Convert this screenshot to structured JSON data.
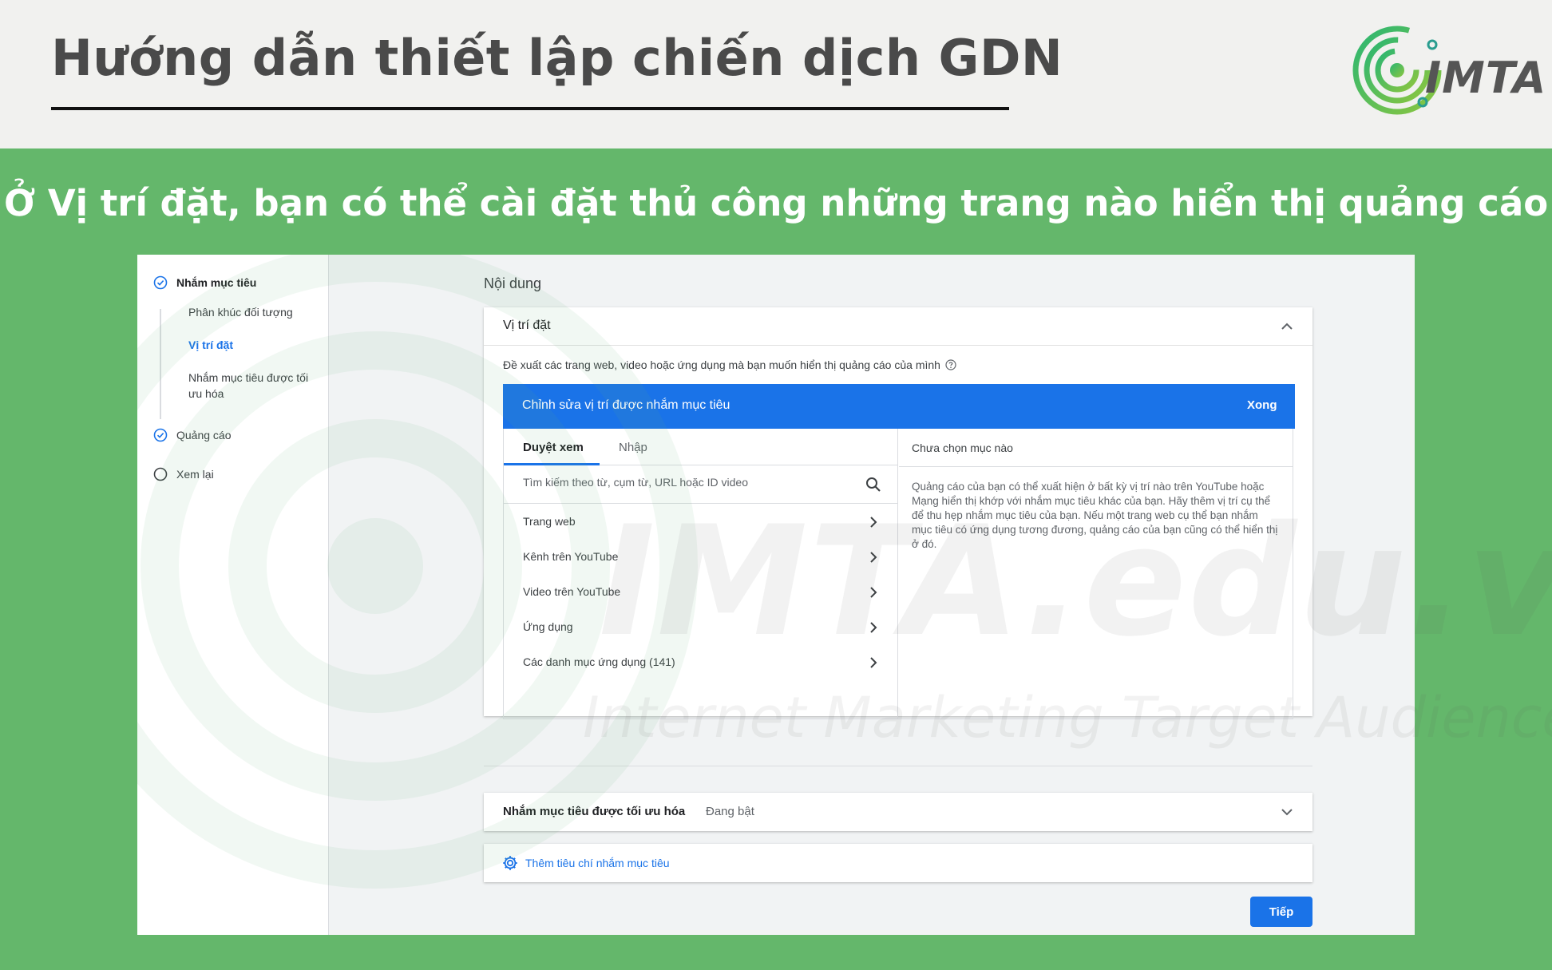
{
  "header": {
    "title": "Hướng dẫn thiết lập chiến dịch GDN",
    "logo_text": "IMTA"
  },
  "subtitle": "Ở Vị trí đặt, bạn có thể cài đặt thủ công những trang nào hiển thị quảng cáo",
  "watermark": {
    "main": "IMTA.edu.vn",
    "sub": "Internet Marketing Target Audience"
  },
  "sidebar": {
    "steps": [
      {
        "label": "Nhắm mục tiêu",
        "icon": "check-circle-icon"
      },
      {
        "label": "Quảng cáo",
        "icon": "check-circle-icon"
      },
      {
        "label": "Xem lại",
        "icon": "empty-circle-icon"
      }
    ],
    "sub_items": [
      {
        "label": "Phân khúc đối tượng"
      },
      {
        "label": "Vị trí đặt"
      },
      {
        "label": "Nhắm mục tiêu được tối ưu hóa"
      }
    ]
  },
  "content": {
    "section_label": "Nội dung",
    "placement_card": {
      "title": "Vị trí đặt",
      "description": "Đề xuất các trang web, video hoặc ứng dụng mà bạn muốn hiển thị quảng cáo của mình",
      "edit_bar_title": "Chỉnh sửa vị trí được nhắm mục tiêu",
      "done_label": "Xong",
      "tabs": [
        {
          "label": "Duyệt xem"
        },
        {
          "label": "Nhập"
        }
      ],
      "search_placeholder": "Tìm kiếm theo từ, cụm từ, URL hoặc ID video",
      "list": [
        {
          "label": "Trang web"
        },
        {
          "label": "Kênh trên YouTube"
        },
        {
          "label": "Video trên YouTube"
        },
        {
          "label": "Ứng dụng"
        },
        {
          "label": "Các danh mục ứng dụng (141)"
        }
      ],
      "right_header": "Chưa chọn mục nào",
      "right_text": "Quảng cáo của bạn có thể xuất hiện ở bất kỳ vị trí nào trên YouTube hoặc Mạng hiển thị khớp với nhắm mục tiêu khác của bạn. Hãy thêm vị trí cụ thể để thu hẹp nhắm mục tiêu của bạn. Nếu một trang web cụ thể bạn nhắm mục tiêu có ứng dụng tương đương, quảng cáo của bạn cũng có thể hiển thị ở đó."
    },
    "optimized_card": {
      "label": "Nhắm mục tiêu được tối ưu hóa",
      "status": "Đang bật"
    },
    "add_criteria_label": "Thêm tiêu chí nhắm mục tiêu",
    "next_label": "Tiếp"
  },
  "colors": {
    "accent": "#1a73e8",
    "green_band": "#64b76b"
  }
}
